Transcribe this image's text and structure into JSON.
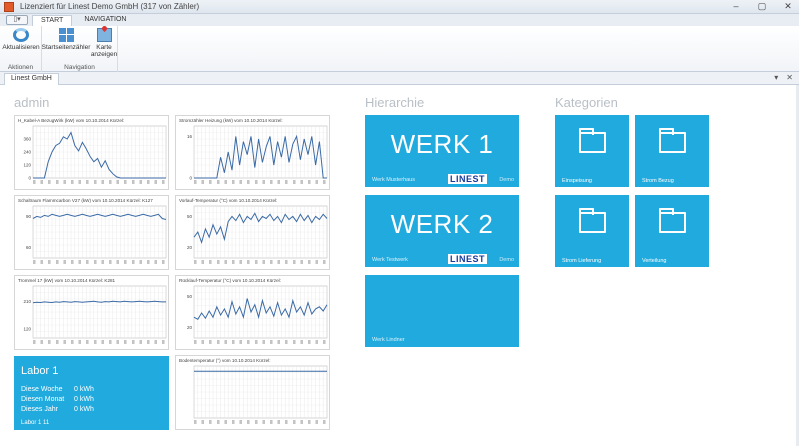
{
  "window": {
    "title": "Lizenziert für Linest Demo GmbH (317 von  Zähler)",
    "controls": [
      "–",
      "▢",
      "✕"
    ]
  },
  "ribbon": {
    "quick_label": "▯▾",
    "tabs": [
      {
        "label": "START",
        "active": true
      },
      {
        "label": "NAVIGATION",
        "active": false
      }
    ],
    "groups": [
      {
        "label": "Aktionen",
        "buttons": [
          {
            "label": "Aktualisieren",
            "icon": "refresh-icon"
          }
        ]
      },
      {
        "label": "Navigation",
        "buttons": [
          {
            "label": "Startseitenzähler",
            "icon": "grid-icon"
          },
          {
            "label": "Karte anzeigen",
            "icon": "map-icon"
          }
        ]
      }
    ]
  },
  "doc_tab": {
    "label": "Linest GmbH",
    "controls": [
      "▾",
      "✕"
    ]
  },
  "sections": {
    "admin": "admin",
    "hierarchie": "Hierarchie",
    "kategorien": "Kategorien"
  },
  "chart_data": [
    {
      "type": "line",
      "title": "H_Kabel-A BezugWirk (kW) vom 10.10.2014 Kürzel:",
      "yticks": [
        0,
        120,
        240,
        360
      ],
      "ylim": [
        0,
        480
      ],
      "x": [
        1,
        2,
        3,
        4,
        5,
        6,
        7,
        8,
        9,
        10,
        11,
        12,
        13,
        14,
        15,
        16,
        17,
        18,
        19,
        20,
        21,
        22,
        23,
        24,
        25,
        26,
        27,
        28,
        29,
        30,
        31,
        32,
        33,
        34,
        35,
        36
      ],
      "values": [
        0,
        0,
        0,
        0,
        150,
        240,
        300,
        320,
        380,
        360,
        420,
        300,
        250,
        330,
        270,
        200,
        150,
        180,
        100,
        160,
        80,
        40,
        10,
        0,
        0,
        0,
        0,
        0,
        0,
        0,
        0,
        0,
        0,
        0,
        0,
        0
      ],
      "xtick_label": "00"
    },
    {
      "type": "line",
      "title": "Stromzähler Heizung (kW) vom 10.10.2014 Kürzel:",
      "yticks": [
        0,
        16
      ],
      "ylim": [
        0,
        20
      ],
      "x": [
        1,
        2,
        3,
        4,
        5,
        6,
        7,
        8,
        9,
        10,
        11,
        12,
        13,
        14,
        15,
        16,
        17,
        18,
        19,
        20,
        21,
        22,
        23,
        24,
        25,
        26,
        27,
        28,
        29,
        30,
        31,
        32,
        33,
        34,
        35,
        36
      ],
      "values": [
        0,
        0,
        0,
        0,
        0,
        0,
        0,
        8,
        2,
        10,
        3,
        16,
        5,
        14,
        9,
        16,
        4,
        15,
        6,
        12,
        16,
        5,
        14,
        8,
        16,
        6,
        13,
        16,
        7,
        15,
        9,
        16,
        5,
        14,
        0,
        0
      ],
      "xtick_label": "00"
    },
    {
      "type": "line",
      "title": "Schaltraum Flammcarbon V27 (kW) vom 10.10.2014 Kürzel: K127",
      "yticks": [
        60,
        90
      ],
      "ylim": [
        50,
        100
      ],
      "x": [
        1,
        2,
        3,
        4,
        5,
        6,
        7,
        8,
        9,
        10,
        11,
        12,
        13,
        14,
        15,
        16,
        17,
        18,
        19,
        20,
        21,
        22,
        23,
        24,
        25,
        26,
        27,
        28,
        29,
        30,
        31,
        32,
        33,
        34,
        35,
        36
      ],
      "values": [
        88,
        90,
        89,
        91,
        90,
        92,
        91,
        90,
        91,
        92,
        91,
        90,
        91,
        92,
        91,
        90,
        91,
        92,
        91,
        90,
        91,
        92,
        91,
        90,
        91,
        92,
        91,
        90,
        91,
        92,
        91,
        90,
        91,
        92,
        88,
        87
      ],
      "xtick_label": "00"
    },
    {
      "type": "line",
      "title": "Vorlauf-Temperatur (°C) vom 10.10.2014 Kürzel:",
      "yticks": [
        20,
        50
      ],
      "ylim": [
        10,
        60
      ],
      "x": [
        1,
        2,
        3,
        4,
        5,
        6,
        7,
        8,
        9,
        10,
        11,
        12,
        13,
        14,
        15,
        16,
        17,
        18,
        19,
        20,
        21,
        22,
        23,
        24,
        25,
        26,
        27,
        28,
        29,
        30,
        31,
        32,
        33,
        34,
        35,
        36
      ],
      "values": [
        30,
        35,
        25,
        38,
        30,
        42,
        33,
        40,
        28,
        45,
        50,
        46,
        52,
        44,
        50,
        47,
        53,
        45,
        50,
        48,
        52,
        46,
        50,
        44,
        52,
        47,
        50,
        45,
        52,
        46,
        51,
        44,
        50,
        47,
        52,
        48
      ],
      "xtick_label": "00"
    },
    {
      "type": "line",
      "title": "Trommel 17  (kW) vom 10.10.2014 Kürzel: K281",
      "yticks": [
        120,
        210
      ],
      "ylim": [
        90,
        260
      ],
      "x": [
        1,
        2,
        3,
        4,
        5,
        6,
        7,
        8,
        9,
        10,
        11,
        12,
        13,
        14,
        15,
        16,
        17,
        18,
        19,
        20,
        21,
        22,
        23,
        24,
        25,
        26,
        27,
        28,
        29,
        30,
        31,
        32,
        33,
        34,
        35,
        36
      ],
      "values": [
        205,
        207,
        206,
        208,
        207,
        206,
        208,
        207,
        209,
        208,
        207,
        209,
        208,
        207,
        208,
        209,
        210,
        208,
        207,
        209,
        208,
        210,
        209,
        208,
        210,
        209,
        208,
        209,
        210,
        209,
        208,
        209,
        210,
        209,
        208,
        208
      ],
      "xtick_label": "00"
    },
    {
      "type": "line",
      "title": "Rücklauf-Temperatur (°C) vom 10.10.2014 Kürzel:",
      "yticks": [
        20,
        50
      ],
      "ylim": [
        10,
        60
      ],
      "x": [
        1,
        2,
        3,
        4,
        5,
        6,
        7,
        8,
        9,
        10,
        11,
        12,
        13,
        14,
        15,
        16,
        17,
        18,
        19,
        20,
        21,
        22,
        23,
        24,
        25,
        26,
        27,
        28,
        29,
        30,
        31,
        32,
        33,
        34,
        35,
        36
      ],
      "values": [
        30,
        28,
        34,
        29,
        36,
        30,
        40,
        32,
        38,
        30,
        45,
        33,
        40,
        30,
        48,
        35,
        42,
        30,
        46,
        34,
        40,
        31,
        44,
        32,
        38,
        30,
        46,
        35,
        40,
        32,
        44,
        33,
        38,
        40,
        36,
        42
      ],
      "xtick_label": "00"
    },
    {
      "type": "line",
      "title": "Bodentemperatur (°) vom 10.10.2014 Kürzel:",
      "yticks": [],
      "ylim": [
        0,
        10
      ],
      "x": [
        1,
        2,
        3,
        4,
        5,
        6,
        7,
        8,
        9,
        10,
        11,
        12,
        13,
        14,
        15,
        16,
        17,
        18,
        19,
        20,
        21,
        22,
        23,
        24,
        25,
        26,
        27,
        28,
        29,
        30,
        31,
        32,
        33,
        34,
        35,
        36
      ],
      "values": [
        9,
        9,
        9,
        9,
        9,
        9,
        9,
        9,
        9,
        9,
        9,
        9,
        9,
        9,
        9,
        9,
        9,
        9,
        9,
        9,
        9,
        9,
        9,
        9,
        9,
        9,
        9,
        9,
        9,
        9,
        9,
        9,
        9,
        9,
        9,
        9
      ],
      "xtick_label": "00"
    }
  ],
  "labor": {
    "title": "Labor 1",
    "rows": [
      {
        "label": "Diese Woche",
        "value": "0 kWh"
      },
      {
        "label": "Diesen Monat",
        "value": "0 kWh"
      },
      {
        "label": "Dieses Jahr",
        "value": "0 kWh"
      }
    ],
    "footer": "Labor 1 11"
  },
  "werke": [
    {
      "title": "WERK 1",
      "sub": "Werk Musterhaus",
      "logo": "LINEST",
      "logo_ext": "Demo"
    },
    {
      "title": "WERK 2",
      "sub": "Werk Testwerk",
      "logo": "LINEST",
      "logo_ext": "Demo"
    },
    {
      "title": "",
      "sub": "Werk Lindner",
      "logo": "",
      "logo_ext": ""
    }
  ],
  "kategorien": [
    {
      "label": "Einspeisung"
    },
    {
      "label": "Strom Bezug"
    },
    {
      "label": "Strom Lieferung"
    },
    {
      "label": "Verteilung"
    }
  ],
  "colors": {
    "tile": "#21aadd",
    "chart_line": "#3a6aa6",
    "section_title": "#b9bfc6"
  }
}
